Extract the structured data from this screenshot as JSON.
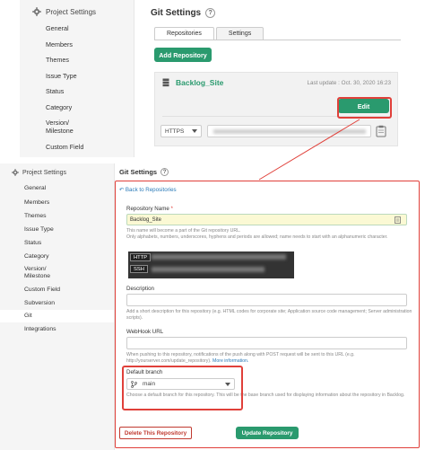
{
  "top": {
    "sidebar": {
      "header": "Project Settings",
      "items": [
        "General",
        "Members",
        "Themes",
        "Issue Type",
        "Status",
        "Category",
        "Version/\nMilestone",
        "Custom Field"
      ]
    },
    "title": "Git Settings",
    "help": "?",
    "tabs": [
      "Repositories",
      "Settings"
    ],
    "add_button": "Add Repository",
    "repo": {
      "name": "Backlog_Site",
      "last_update": "Last update : Oct. 30, 2020 16:23",
      "edit_button": "Edit",
      "protocol": "HTTPS"
    }
  },
  "bottom": {
    "sidebar": {
      "header": "Project Settings",
      "items": [
        "General",
        "Members",
        "Themes",
        "Issue Type",
        "Status",
        "Category",
        "Version/\nMilestone",
        "Custom Field",
        "Subversion",
        "Git",
        "Integrations"
      ],
      "active": "Git"
    },
    "title": "Git Settings",
    "help": "?",
    "back_link": "Back to Repositories",
    "repo_name_label": "Repository Name",
    "required_mark": "*",
    "repo_name_value": "Backlog_Site",
    "repo_name_help": "This name will become a part of the Git repository URL.\nOnly alphabets, numbers, underscores, hyphens and periods are allowed; name needs to start with an alphanumeric character.",
    "http_tag": "HTTP",
    "ssh_tag": "SSH",
    "description_label": "Description",
    "description_help": "Add a short description for this repository (e.g. HTML codes for corporate site; Application source code management; Server administration scripts).",
    "webhook_label": "WebHook URL",
    "webhook_help_prefix": "When pushing to this repository, notifications of the push along with POST request will be sent to this URL (e.g. http://yourserver.com/update_repository). ",
    "webhook_more": "More information.",
    "default_branch_label": "Default branch",
    "default_branch_value": "main",
    "default_branch_help": "Choose a default branch for this repository. This will be the base branch used for displaying information about the repository in Backlog.",
    "delete_button": "Delete This Repository",
    "update_button": "Update Repository"
  },
  "colors": {
    "accent_green": "#2a9a6e",
    "highlight_red": "#e0403a",
    "link_blue": "#2a7ab8"
  }
}
